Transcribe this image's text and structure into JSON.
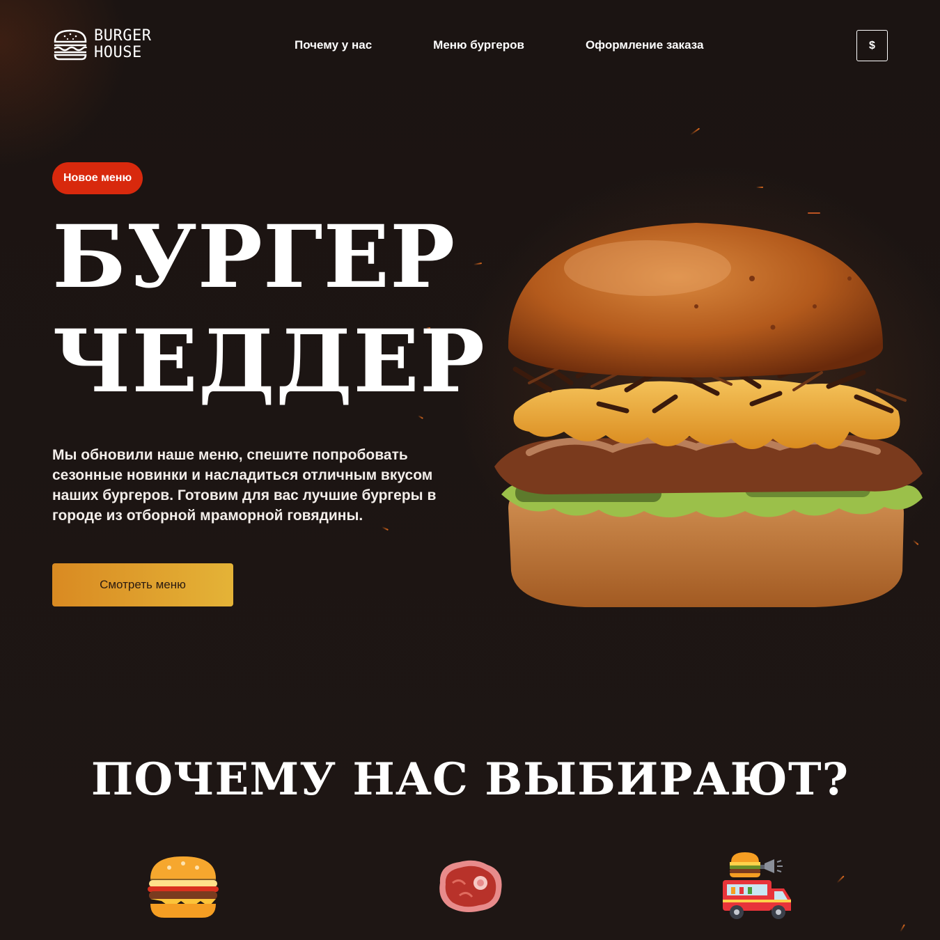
{
  "brand": {
    "line1": "BURGER",
    "line2": "HOUSE"
  },
  "nav": [
    {
      "label": "Почему у нас"
    },
    {
      "label": "Меню бургеров"
    },
    {
      "label": "Оформление заказа"
    }
  ],
  "currency": "$",
  "hero": {
    "badge": "Новое меню",
    "title_line1": "БУРГЕР",
    "title_line2": "ЧЕДДЕР",
    "description": "Мы обновили наше меню, спешите попробовать сезонные новинки и насладиться отличным вкусом наших бургеров. Готовим для вас лучшие бургеры в городе из отборной мраморной говядины.",
    "cta": "Смотреть меню"
  },
  "why": {
    "title": "ПОЧЕМУ НАС ВЫБИРАЮТ?",
    "features": [
      {
        "icon": "burger-icon"
      },
      {
        "icon": "steak-icon"
      },
      {
        "icon": "food-truck-icon"
      }
    ]
  },
  "colors": {
    "background": "#1c1513",
    "badge": "#d8290d",
    "cta_start": "#d98a22",
    "cta_end": "#e4b337"
  }
}
